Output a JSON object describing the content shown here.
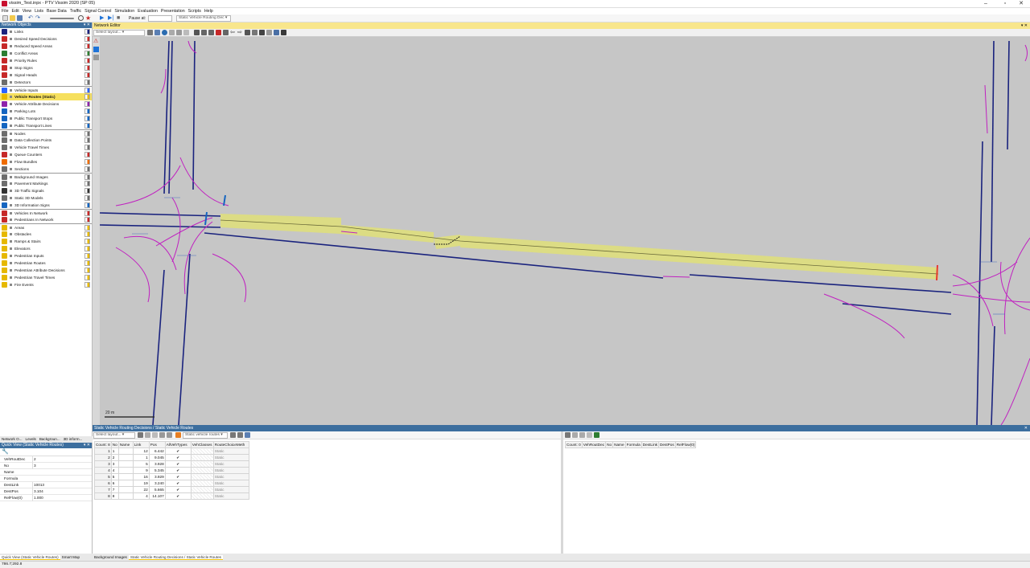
{
  "window": {
    "title": "vissim_Test.inpx - PTV Vissim 2020 (SP 05)"
  },
  "menu": [
    "File",
    "Edit",
    "View",
    "Lists",
    "Base Data",
    "Traffic",
    "Signal Control",
    "Simulation",
    "Evaluation",
    "Presentation",
    "Scripts",
    "Help"
  ],
  "toolbar": {
    "pause_label": "Pause at:",
    "pause_value": "",
    "layer_select": "Static Vehicle Routing Dec"
  },
  "network_objects": {
    "title": "Network Objects",
    "items": [
      {
        "label": "Links",
        "color": "#1a237e"
      },
      {
        "label": "Desired Speed Decisions",
        "color": "#c62828"
      },
      {
        "label": "Reduced Speed Areas",
        "color": "#c62828"
      },
      {
        "label": "Conflict Areas",
        "color": "#2e7d32"
      },
      {
        "label": "Priority Rules",
        "color": "#c62828"
      },
      {
        "label": "Stop Signs",
        "color": "#c62828"
      },
      {
        "label": "Signal Heads",
        "color": "#c62828"
      },
      {
        "label": "Detectors",
        "color": "#6d6d6d"
      },
      {
        "label": "Vehicle Inputs",
        "color": "#2962ff"
      },
      {
        "label": "Vehicle Routes (Static)",
        "color": "#e6b800"
      },
      {
        "label": "Vehicle Attribute Decisions",
        "color": "#8e24aa"
      },
      {
        "label": "Parking Lots",
        "color": "#1565c0"
      },
      {
        "label": "Public Transport Stops",
        "color": "#1565c0"
      },
      {
        "label": "Public Transport Lines",
        "color": "#1565c0"
      },
      {
        "label": "Nodes",
        "color": "#6d6d6d"
      },
      {
        "label": "Data Collection Points",
        "color": "#6d6d6d"
      },
      {
        "label": "Vehicle Travel Times",
        "color": "#6d6d6d"
      },
      {
        "label": "Queue Counters",
        "color": "#c62828"
      },
      {
        "label": "Flow Bundles",
        "color": "#ef6c00"
      },
      {
        "label": "Sections",
        "color": "#6d6d6d"
      },
      {
        "label": "Background Images",
        "color": "#6d6d6d"
      },
      {
        "label": "Pavement Markings",
        "color": "#6d6d6d"
      },
      {
        "label": "3D Traffic Signals",
        "color": "#333333"
      },
      {
        "label": "Static 3D Models",
        "color": "#6d6d6d"
      },
      {
        "label": "3D Information Signs",
        "color": "#1565c0"
      },
      {
        "label": "Vehicles In Network",
        "color": "#c62828"
      },
      {
        "label": "Pedestrians In Network",
        "color": "#c62828"
      },
      {
        "label": "Areas",
        "color": "#e6b800"
      },
      {
        "label": "Obstacles",
        "color": "#e6b800"
      },
      {
        "label": "Ramps & Stairs",
        "color": "#e6b800"
      },
      {
        "label": "Elevators",
        "color": "#e6b800"
      },
      {
        "label": "Pedestrian Inputs",
        "color": "#e6b800"
      },
      {
        "label": "Pedestrian Routes",
        "color": "#e6b800"
      },
      {
        "label": "Pedestrian Attribute Decisions",
        "color": "#e6b800"
      },
      {
        "label": "Pedestrian Travel Times",
        "color": "#e6b800"
      },
      {
        "label": "Fire Events",
        "color": "#e6b800"
      }
    ]
  },
  "left_tabs": [
    "Network O...",
    "Levels",
    "Backgroun...",
    "3D inform..."
  ],
  "quick_view": {
    "title": "Quick View (Static Vehicle Routes)",
    "rows": [
      {
        "k": "VehRoutDec",
        "v": "2"
      },
      {
        "k": "No",
        "v": "3"
      },
      {
        "k": "Name",
        "v": ""
      },
      {
        "k": "Formula",
        "v": ""
      },
      {
        "k": "DestLink",
        "v": "10013"
      },
      {
        "k": "DestPos",
        "v": "3.104"
      },
      {
        "k": "RelFlow(0)",
        "v": "1.000"
      }
    ],
    "tabs": [
      "Quick View (Static Vehicle Routes)",
      "Smart Map"
    ]
  },
  "editor": {
    "title": "Network Editor",
    "layout": "Select layout...",
    "scale": "20 m"
  },
  "lists": {
    "title": "Static Vehicle Routing Decisions / Static Vehicle Routes",
    "layout": "Select layout...",
    "relation": "Static vehicle routes",
    "left_headers": [
      "Count: 8",
      "No",
      "Name",
      "Link",
      "Pos",
      "AllVehTypes",
      "VehClasses",
      "RouteChoiceMeth"
    ],
    "left_rows": [
      [
        "1",
        "1",
        "",
        "12",
        "6.442",
        "✔",
        "",
        "Static"
      ],
      [
        "2",
        "2",
        "",
        "1",
        "9.045",
        "✔",
        "",
        "Static"
      ],
      [
        "3",
        "3",
        "",
        "5",
        "3.928",
        "✔",
        "",
        "Static"
      ],
      [
        "4",
        "4",
        "",
        "9",
        "5.345",
        "✔",
        "",
        "Static"
      ],
      [
        "5",
        "5",
        "",
        "16",
        "3.929",
        "✔",
        "",
        "Static"
      ],
      [
        "6",
        "6",
        "",
        "19",
        "3.240",
        "✔",
        "",
        "Static"
      ],
      [
        "7",
        "7",
        "",
        "22",
        "5.665",
        "✔",
        "",
        "Static"
      ],
      [
        "8",
        "8",
        "",
        "4",
        "14.107",
        "✔",
        "",
        "Static"
      ]
    ],
    "right_headers": [
      "Count: 0",
      "VehRoutDec",
      "No",
      "Name",
      "Formula",
      "DestLink",
      "DestPos",
      "RelFlow(0)"
    ]
  },
  "bottom_tabs": [
    "Background Images",
    "Static Vehicle Routing Decisions / Static Vehicle Routes"
  ],
  "status": {
    "coords": "786.7;292.8"
  },
  "colors": {
    "link": "#1a237e",
    "connector": "#c020c0",
    "route": "#dede7c",
    "panel_header": "#3c6e9e",
    "editor_bg": "#c6c6c6"
  }
}
